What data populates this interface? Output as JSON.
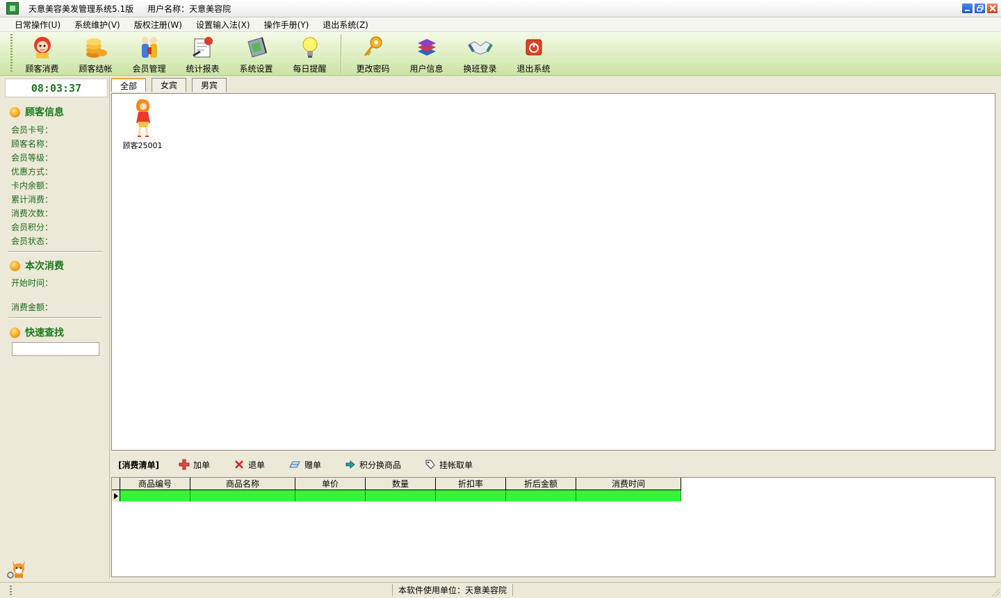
{
  "window": {
    "title": "天意美容美发管理系统5.1版",
    "user_text": "用户名称：天意美容院",
    "buttons": [
      "minimize",
      "restore",
      "close"
    ]
  },
  "menu": [
    "日常操作(U)",
    "系统维护(V)",
    "版权注册(W)",
    "设置输入法(X)",
    "操作手册(Y)",
    "退出系统(Z)"
  ],
  "toolbar": {
    "items": [
      {
        "label": "顾客消费",
        "icon": "customer-consumption-icon"
      },
      {
        "label": "顾客结帐",
        "icon": "coins-checkout-icon"
      },
      {
        "label": "会员管理",
        "icon": "members-icon"
      },
      {
        "label": "统计报表",
        "icon": "report-icon"
      },
      {
        "label": "系统设置",
        "icon": "settings-icon"
      },
      {
        "label": "每日提醒",
        "icon": "lightbulb-icon"
      }
    ],
    "items2": [
      {
        "label": "更改密码",
        "icon": "key-icon"
      },
      {
        "label": "用户信息",
        "icon": "books-icon"
      },
      {
        "label": "换班登录",
        "icon": "handshake-icon"
      },
      {
        "label": "退出系统",
        "icon": "power-icon"
      }
    ]
  },
  "left": {
    "clock": "08:03:37",
    "customer_info": {
      "title": "顾客信息",
      "fields": [
        "会员卡号：",
        "顾客名称：",
        "会员等级：",
        "优惠方式：",
        "卡内余额：",
        "累计消费：",
        "消费次数：",
        "会员积分：",
        "会员状态："
      ]
    },
    "current": {
      "title": "本次消费",
      "start_time": "开始时间：",
      "amount": "消费金额："
    },
    "quick_search": {
      "title": "快速查找",
      "value": ""
    }
  },
  "tabs": [
    "全部",
    "女宾",
    "男宾"
  ],
  "customers": [
    {
      "name": "顾客25001"
    }
  ],
  "order": {
    "title": "[消费清单]",
    "buttons": [
      "加单",
      "退单",
      "赠单",
      "积分换商品",
      "挂帐取单"
    ]
  },
  "grid": {
    "columns": [
      "商品编号",
      "商品名称",
      "单价",
      "数量",
      "折扣率",
      "折后金额",
      "消费时间"
    ],
    "row_color": "#35f535"
  },
  "status": {
    "text": "本软件使用单位：天意美容院"
  },
  "colors": {
    "toolbar_green": "#dcedbd",
    "label_green": "#1a6b1a",
    "row_highlight": "#35f535"
  }
}
